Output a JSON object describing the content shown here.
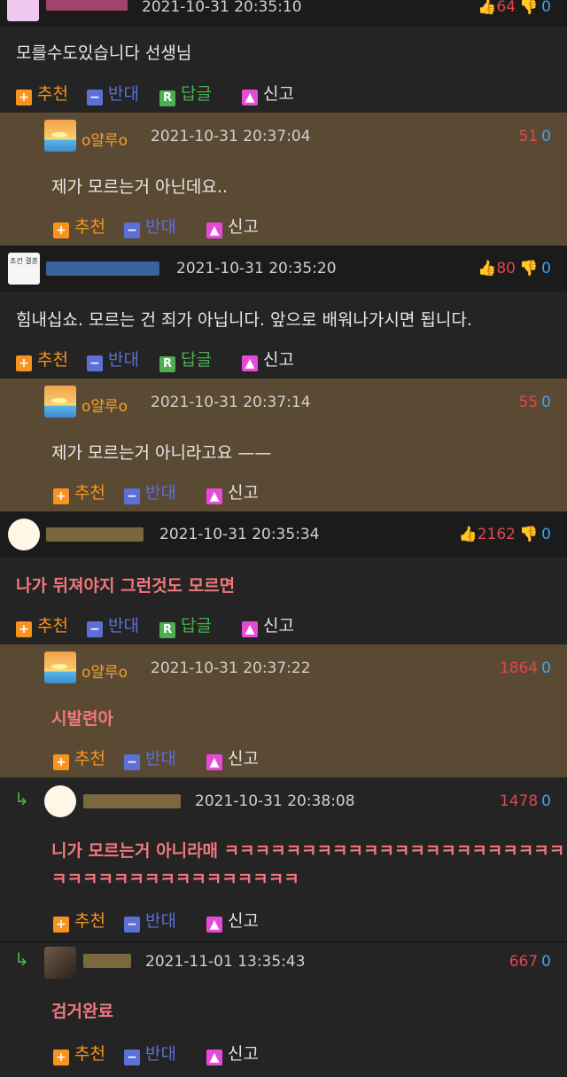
{
  "labels": {
    "recommend": "추천",
    "oppose": "반대",
    "reply": "답글",
    "report": "신고"
  },
  "c0": {
    "date": "2021-10-31 20:35:10",
    "up": "64",
    "down": "0",
    "text": "모를수도있습니다 선생님"
  },
  "c1": {
    "name": "o얄루o",
    "date": "2021-10-31 20:37:04",
    "up": "51",
    "down": "0",
    "text": "제가 모르는거 아닌데요.."
  },
  "c2": {
    "date": "2021-10-31 20:35:20",
    "up": "80",
    "down": "0",
    "text": "힘내십쇼. 모르는 건 죄가 아닙니다. 앞으로 배워나가시면 됩니다.",
    "avatar_text": "조건 결혼"
  },
  "c3": {
    "name": "o얄루o",
    "date": "2021-10-31 20:37:14",
    "up": "55",
    "down": "0",
    "text": "제가 모르는거 아니라고요 ——"
  },
  "c4": {
    "date": "2021-10-31 20:35:34",
    "up": "2162",
    "down": "0",
    "text": "나가 뒤져야지 그런것도 모르면"
  },
  "c5": {
    "name": "o얄루o",
    "date": "2021-10-31 20:37:22",
    "up": "1864",
    "down": "0",
    "text": "시발련아"
  },
  "c6": {
    "date": "2021-10-31 20:38:08",
    "up": "1478",
    "down": "0",
    "text1": "니가 모르는거 아니라매 ㅋㅋㅋㅋㅋㅋㅋㅋㅋㅋㅋㅋㅋㅋㅋㅋㅋㅋㅋㅋㅋㅋ",
    "text2": "ㅋㅋㅋㅋㅋㅋㅋㅋㅋㅋㅋㅋㅋㅋㅋㅋ"
  },
  "c7": {
    "date": "2021-11-01 13:35:43",
    "up": "667",
    "down": "0",
    "text": "검거완료"
  },
  "colors": {
    "accent_orange": "#f7931e",
    "oppose_blue": "#5b6fd6",
    "reply_green": "#4caf50",
    "report_pink": "#e54ad8",
    "upvote_red": "#e0464f",
    "downvote_blue": "#3ea1f0",
    "reply_bg": "#5b4a33"
  },
  "icons": [
    "thumbs-up-icon",
    "thumbs-down-icon",
    "plus-icon",
    "minus-icon",
    "reply-r-icon",
    "siren-icon",
    "reply-arrow-icon"
  ]
}
